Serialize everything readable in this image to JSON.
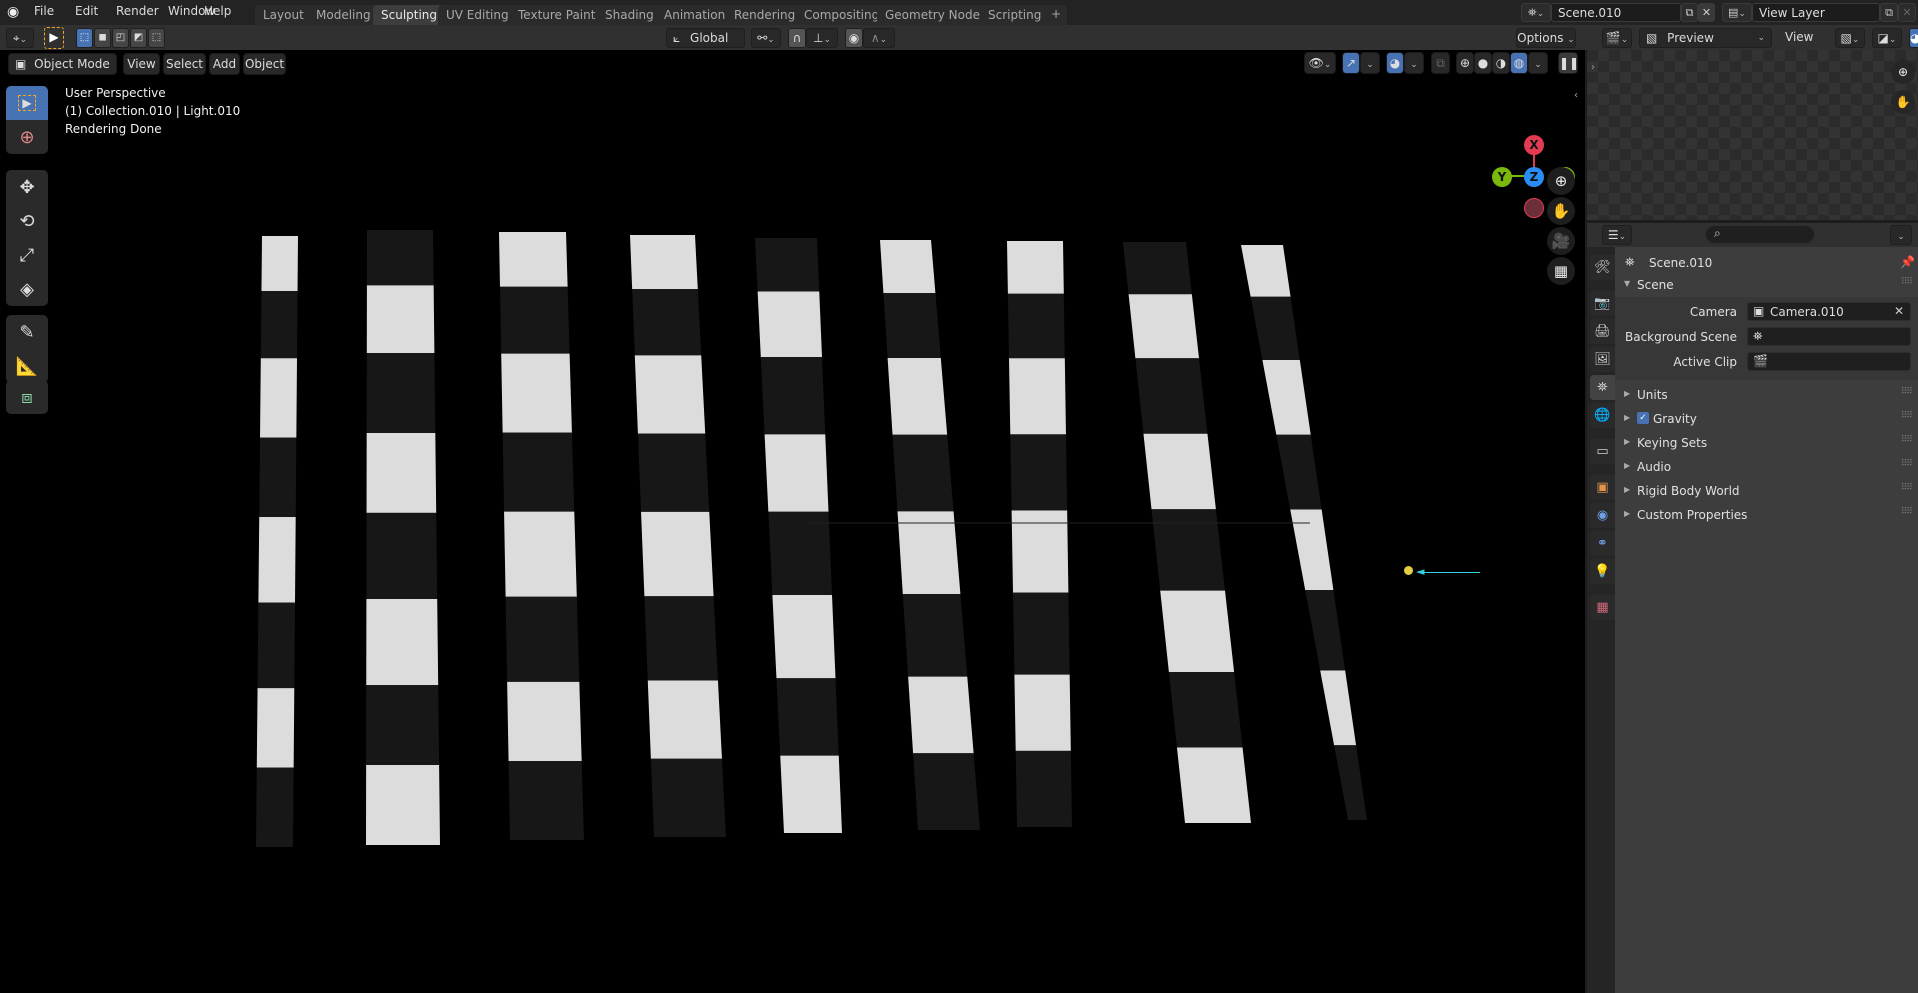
{
  "app": {
    "logo_icon": "blender-logo-icon"
  },
  "menu": {
    "items": [
      "File",
      "Edit",
      "Render",
      "Window",
      "Help"
    ]
  },
  "workspace_tabs": [
    {
      "label": "Layout",
      "active": false
    },
    {
      "label": "Modeling",
      "active": false
    },
    {
      "label": "Sculpting",
      "active": true
    },
    {
      "label": "UV Editing",
      "active": false
    },
    {
      "label": "Texture Paint",
      "active": false
    },
    {
      "label": "Shading",
      "active": false
    },
    {
      "label": "Animation",
      "active": false
    },
    {
      "label": "Rendering",
      "active": false
    },
    {
      "label": "Compositing",
      "active": false
    },
    {
      "label": "Geometry Nodes",
      "active": false
    },
    {
      "label": "Scripting",
      "active": false
    }
  ],
  "add_workspace_label": "+",
  "scene_selector": {
    "value": "Scene.010",
    "icon": "scene-icon"
  },
  "view_layer_selector": {
    "value": "View Layer",
    "icon": "view-layer-icon"
  },
  "tool_header": {
    "transform_orientation": "Global",
    "options_label": "Options"
  },
  "viewport_header": {
    "mode": "Object Mode",
    "menus": [
      "View",
      "Select",
      "Add",
      "Object"
    ]
  },
  "viewport_overlay": {
    "perspective": "User Perspective",
    "collection": "(1) Collection.010 | Light.010",
    "status": "Rendering Done"
  },
  "gizmo": {
    "x_label": "X",
    "y_label": "Y",
    "z_label": "Z",
    "colors": {
      "x": "#e23b52",
      "y": "#7ab80e",
      "z": "#2a8cf5"
    }
  },
  "toolbar": {
    "tools": [
      "select-box",
      "cursor",
      "move",
      "rotate",
      "scale",
      "transform",
      "annotate",
      "measure",
      "add-cube"
    ]
  },
  "navigation": [
    "zoom",
    "pan",
    "camera-view",
    "perspective-toggle"
  ],
  "preview_editor": {
    "slot": "Preview",
    "view_label": "View"
  },
  "properties": {
    "search_placeholder": "",
    "breadcrumb": "Scene.010",
    "scene_panel": {
      "title": "Scene",
      "camera_label": "Camera",
      "camera_value": "Camera.010",
      "background_scene_label": "Background Scene",
      "background_scene_value": "",
      "active_clip_label": "Active Clip",
      "active_clip_value": ""
    },
    "collapsed_panels": [
      {
        "label": "Units",
        "checkbox": false
      },
      {
        "label": "Gravity",
        "checkbox": true,
        "checked": true
      },
      {
        "label": "Keying Sets",
        "checkbox": false
      },
      {
        "label": "Audio",
        "checkbox": false
      },
      {
        "label": "Rigid Body World",
        "checkbox": false
      },
      {
        "label": "Custom Properties",
        "checkbox": false
      }
    ],
    "tabs": [
      "tool",
      "render",
      "output",
      "view-layer",
      "scene",
      "world",
      "collection",
      "object",
      "physics",
      "constraints",
      "data-light",
      "texture"
    ],
    "active_tab": "scene"
  },
  "colors": {
    "accent": "#4772b3",
    "select_outline": "#f5a623"
  }
}
